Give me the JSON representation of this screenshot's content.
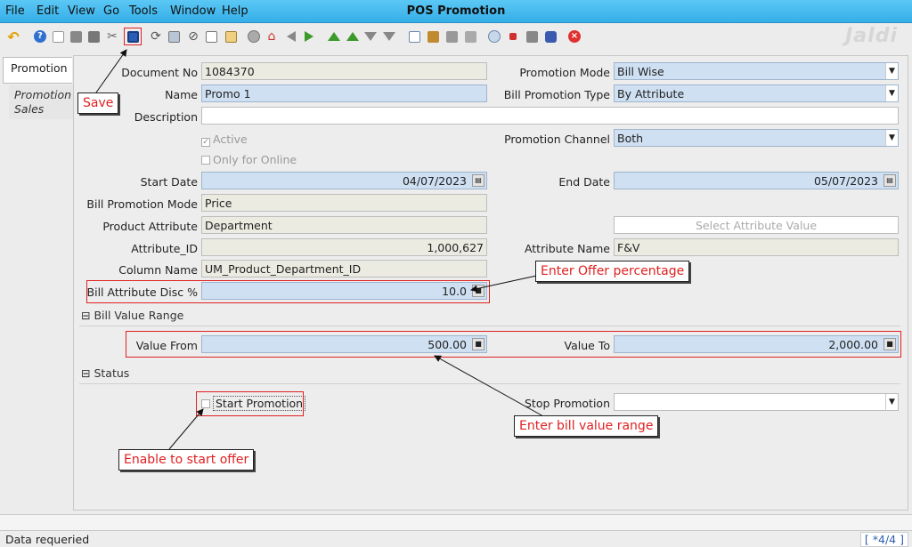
{
  "window": {
    "title": "POS Promotion"
  },
  "menu": {
    "file": "File",
    "edit": "Edit",
    "view": "View",
    "go": "Go",
    "tools": "Tools",
    "window": "Window",
    "help": "Help"
  },
  "toolbar": {
    "icons": [
      "undo-icon",
      "help-icon",
      "new-icon",
      "copy-icon",
      "delete-icon",
      "delete-selection-icon",
      "save-icon",
      "refresh-icon",
      "find-icon",
      "attachment-icon",
      "chat-icon",
      "history-icon",
      "grid-toggle-icon",
      "home-icon",
      "previous-icon",
      "next-icon",
      "first-record-icon",
      "parent-icon",
      "detail-icon",
      "last-record-icon",
      "report-icon",
      "archive-icon",
      "print-icon",
      "print-preview-icon",
      "zoom-across-icon",
      "workflow-icon",
      "product-info-icon",
      "database-icon",
      "close-icon"
    ]
  },
  "logo": "Jaldi",
  "tabs": {
    "active": "Promotion",
    "second": "Promotion Sales"
  },
  "fields": {
    "document_no": {
      "label": "Document No",
      "value": "1084370"
    },
    "name": {
      "label": "Name",
      "value": "Promo 1"
    },
    "description": {
      "label": "Description",
      "value": ""
    },
    "active": {
      "label": "Active",
      "checked": true
    },
    "online": {
      "label": "Only for Online",
      "checked": false
    },
    "start_date": {
      "label": "Start Date",
      "value": "04/07/2023"
    },
    "bill_promotion_mode": {
      "label": "Bill Promotion Mode",
      "value": "Price"
    },
    "product_attribute": {
      "label": "Product Attribute",
      "value": "Department"
    },
    "attribute_id": {
      "label": "Attribute_ID",
      "value": "1,000,627"
    },
    "column_name": {
      "label": "Column Name",
      "value": "UM_Product_Department_ID"
    },
    "bill_attr_disc": {
      "label": "Bill Attribute Disc %",
      "value": "10.0"
    },
    "promotion_mode": {
      "label": "Promotion Mode",
      "value": "Bill Wise"
    },
    "bill_promotion_type": {
      "label": "Bill Promotion Type",
      "value": "By Attribute"
    },
    "promotion_channel": {
      "label": "Promotion Channel",
      "value": "Both"
    },
    "end_date": {
      "label": "End Date",
      "value": "05/07/2023"
    },
    "select_attribute": {
      "label": "Select Attribute Value"
    },
    "attribute_name": {
      "label": "Attribute Name",
      "value": "F&V"
    }
  },
  "sections": {
    "bill_value_range": {
      "title": "Bill Value Range"
    },
    "status": {
      "title": "Status"
    }
  },
  "value_range": {
    "from": {
      "label": "Value From",
      "value": "500.00"
    },
    "to": {
      "label": "Value To",
      "value": "2,000.00"
    }
  },
  "status_section": {
    "start": {
      "label": "Start Promotion",
      "checked": false
    },
    "stop": {
      "label": "Stop Promotion",
      "value": ""
    }
  },
  "callouts": {
    "save": "Save",
    "offer": "Enter Offer percentage",
    "range": "Enter bill value range",
    "start": "Enable to start offer"
  },
  "statusbar": {
    "message": "Data requeried",
    "record": "[ *4/4 ]"
  },
  "colors": {
    "titlebar": "#35aee8",
    "field_blue": "#cfe0f3",
    "annotation_red": "#e02020"
  }
}
